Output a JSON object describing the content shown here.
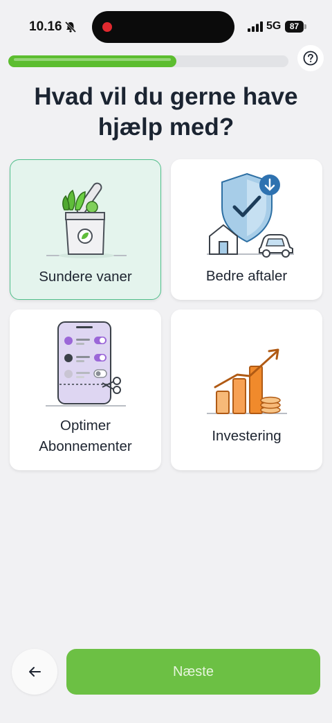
{
  "status_bar": {
    "time": "10.16",
    "network": "5G",
    "battery": "87"
  },
  "progress": {
    "value": 0.6
  },
  "title": "Hvad vil du gerne have hjælp med?",
  "options": [
    {
      "label": "Sundere vaner",
      "selected": true
    },
    {
      "label": "Bedre aftaler",
      "selected": false
    },
    {
      "label": "Optimer Abonnementer",
      "selected": false
    },
    {
      "label": "Investering",
      "selected": false
    }
  ],
  "footer": {
    "back_icon": "arrow-left-icon",
    "next_label": "Næste"
  },
  "colors": {
    "accent_green": "#6cc044",
    "selected_bg": "#e4f4ed",
    "selected_border": "#4fbf8a"
  }
}
